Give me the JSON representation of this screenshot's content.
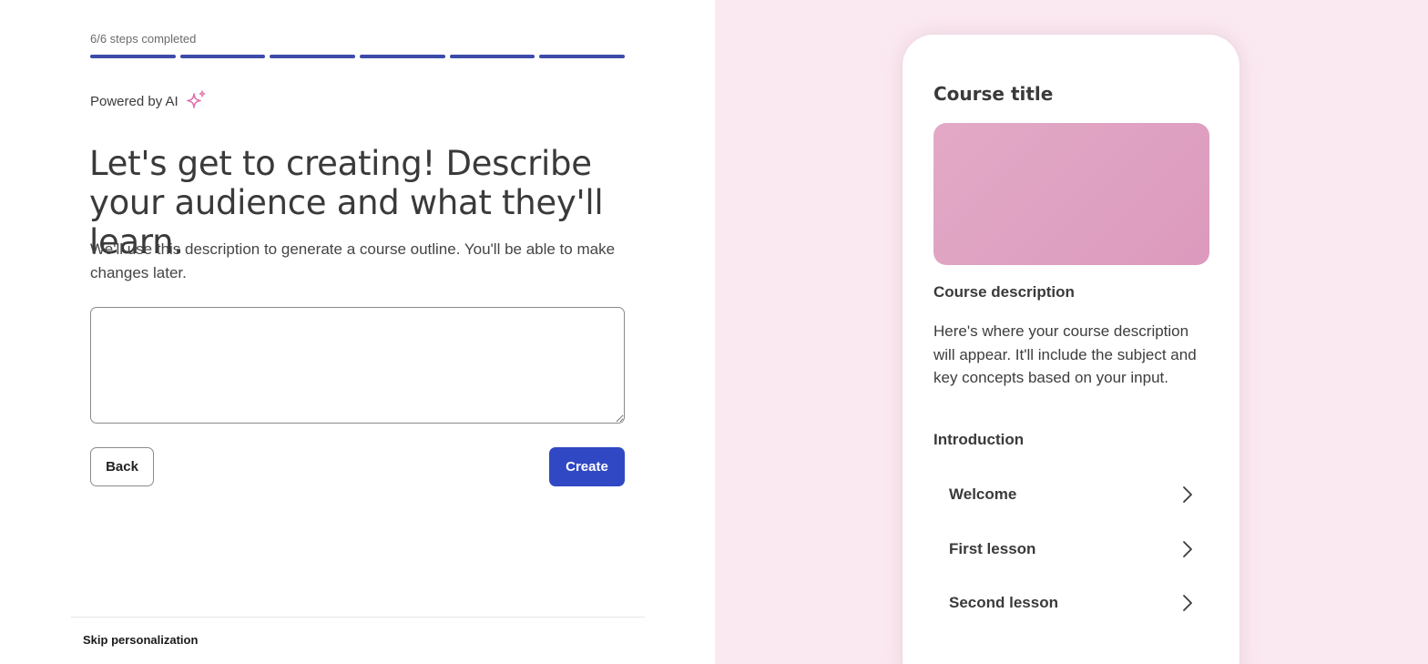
{
  "progress": {
    "label": "6/6 steps completed",
    "completed": 6,
    "total": 6,
    "color": "#3c4ba8"
  },
  "powered": {
    "label": "Powered by AI",
    "icon": "sparkle-icon",
    "icon_color": "#e06fab"
  },
  "main": {
    "headline": "Let's get to creating! Describe your audience and what they'll learn.",
    "subtext": "We'll use this description to generate a course outline. You'll be able to make changes later.",
    "description_value": ""
  },
  "actions": {
    "back_label": "Back",
    "create_label": "Create",
    "create_color": "#3148c4"
  },
  "footer": {
    "skip_label": "Skip personalization"
  },
  "preview": {
    "background": "#fbe9f1",
    "course_title": "Course title",
    "description_heading": "Course description",
    "description_body": "Here's where your course description will appear. It'll include the subject and key concepts based on your input.",
    "section_heading": "Introduction",
    "lessons": [
      {
        "label": "Welcome",
        "icon": "chevron-right-icon"
      },
      {
        "label": "First lesson",
        "icon": "chevron-right-icon"
      },
      {
        "label": "Second lesson",
        "icon": "chevron-right-icon"
      }
    ]
  }
}
